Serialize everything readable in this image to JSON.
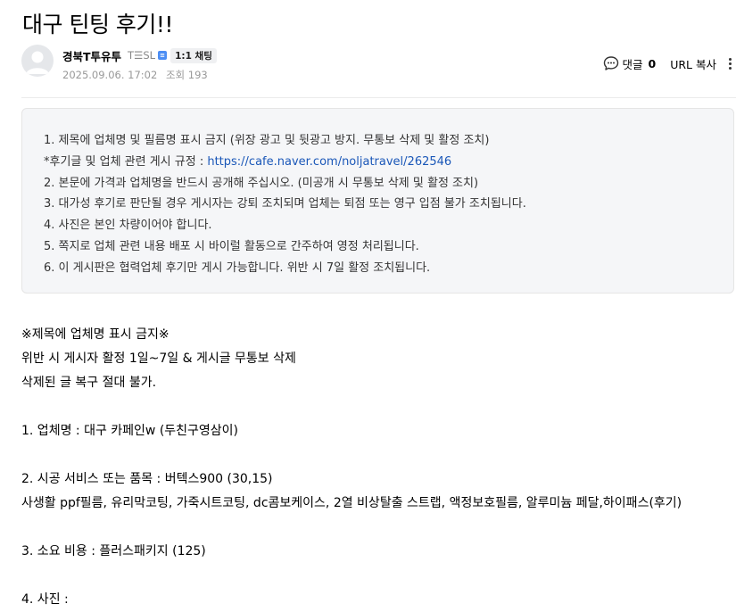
{
  "post": {
    "title": "대구 틴팅 후기!!",
    "author_name": "경북T투유투",
    "author_grade": "T☰SL",
    "grade_badge": "≡",
    "chat_label": "1:1 채팅",
    "date": "2025.09.06. 17:02",
    "view_label": "조회",
    "view_count": "193"
  },
  "actions": {
    "comment_label": "댓글",
    "comment_count": "0",
    "url_copy_label": "URL 복사"
  },
  "notice": {
    "lines": [
      "1. 제목에 업체명 및 필름명 표시 금지 (위장 광고 및 뒷광고 방지. 무통보 삭제 및 활정 조치)",
      "*후기글 및 업체 관련 게시 규정 : ",
      "2. 본문에 가격과 업체명을 반드시 공개해 주십시오. (미공개 시 무통보 삭제 및 활정 조치)",
      "3. 대가성 후기로 판단될 경우 게시자는 강퇴 조치되며 업체는 퇴점 또는 영구 입점 불가 조치됩니다.",
      "4. 사진은 본인 차량이어야 합니다.",
      "5. 쪽지로 업체 관련 내용 배포 시 바이럴 활동으로 간주하여 영정 처리됩니다.",
      "6. 이 게시판은 협력업체 후기만 게시 가능합니다. 위반 시 7일 활정 조치됩니다."
    ],
    "link_text": "https://cafe.naver.com/noljatravel/262546"
  },
  "content": {
    "lines": [
      "※제목에 업체명 표시 금지※",
      "위반 시 게시자 활정 1일~7일 & 게시글 무통보 삭제",
      "삭제된 글 복구 절대 불가.",
      "",
      "1. 업체명 :  대구 카페인w (두친구영삼이)",
      "",
      "2. 시공 서비스 또는 품목 :  버텍스900 (30,15)",
      "사생활 ppf필름, 유리막코팅, 가죽시트코팅, dc콤보케이스, 2열 비상탈출 스트랩, 액정보호필름, 알루미늄 페달,하이패스(후기)",
      "",
      "3. 소요 비용 : 플러스패키지 (125)",
      "",
      "4. 사진 :"
    ]
  },
  "colors": {
    "link": "#1a57b8",
    "notice_bg": "#f5f6f8",
    "meta_text": "#999999",
    "grade_badge": "#4c8ef4"
  }
}
